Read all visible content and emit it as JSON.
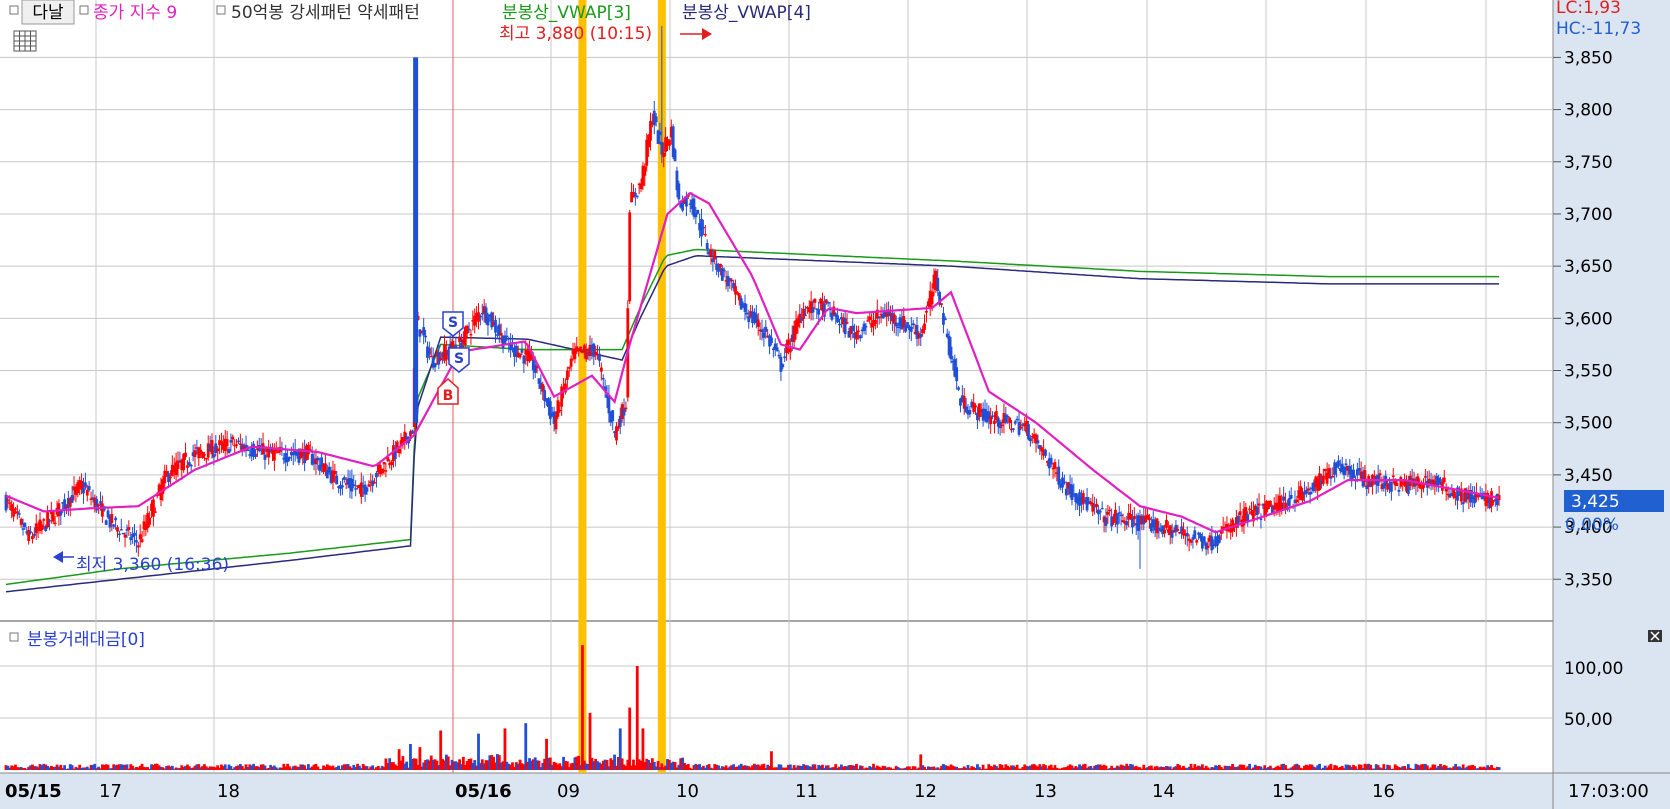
{
  "colors": {
    "up": "#ff0000",
    "down": "#1f4fd6",
    "ma": "#e020c0",
    "vwap3": "#1a9a1a",
    "vwap4": "#2a2a7a",
    "highlight": "#ffc000",
    "grid": "#c8c8c8",
    "axis_bg": "#dbe5f1",
    "price_badge": "#2060d0"
  },
  "header": {
    "button_label": "다날",
    "ma_label": "종가 지수 9",
    "pattern_label": "50억봉 강세패턴 약세패턴",
    "vwap3_label": "분봉상_VWAP[3]",
    "vwap4_label": "분봉상_VWAP[4]",
    "lc_label": "LC:1,93",
    "hc_label": "HC:-11,73"
  },
  "annotations": {
    "high_label": "최고 3,880 (10:15)",
    "low_label": "최저 3,360 (16:36)",
    "current_price": "3,425",
    "current_change": "0,00%",
    "signals": [
      "S",
      "S",
      "B"
    ]
  },
  "volume_panel": {
    "title": "분봉거래대금[0]",
    "close_icon": "x",
    "ticks": [
      "100,00",
      "50,00"
    ]
  },
  "time_axis": {
    "labels": [
      "05/15",
      "17",
      "18",
      "05/16",
      "09",
      "10",
      "11",
      "12",
      "13",
      "14",
      "15",
      "16"
    ],
    "current_time": "17:03:00"
  },
  "chart_data": {
    "type": "candlestick",
    "price_axis": {
      "ticks": [
        "3,850",
        "3,800",
        "3,750",
        "3,700",
        "3,650",
        "3,600",
        "3,550",
        "3,500",
        "3,450",
        "3,400",
        "3,350"
      ],
      "range": [
        3310,
        3905
      ]
    },
    "volume_axis": {
      "range": [
        0,
        125
      ]
    },
    "sessions": [
      {
        "date": "05/15",
        "hours": [
          "16",
          "17",
          "18"
        ]
      },
      {
        "date": "05/16",
        "hours": [
          "08",
          "09",
          "10",
          "11",
          "12",
          "13",
          "14",
          "15",
          "16"
        ]
      }
    ],
    "high": {
      "value": 3880,
      "time": "10:15"
    },
    "low": {
      "value": 3360,
      "time": "16:36"
    },
    "last_close": 3425,
    "price_anchors": [
      [
        0,
        3425
      ],
      [
        12,
        3390
      ],
      [
        25,
        3410
      ],
      [
        40,
        3440
      ],
      [
        55,
        3405
      ],
      [
        70,
        3385
      ],
      [
        85,
        3450
      ],
      [
        100,
        3470
      ],
      [
        120,
        3480
      ],
      [
        140,
        3470
      ],
      [
        160,
        3470
      ],
      [
        175,
        3445
      ],
      [
        188,
        3435
      ],
      [
        200,
        3460
      ],
      [
        210,
        3480
      ],
      [
        215,
        3495
      ],
      [
        217,
        3600
      ],
      [
        225,
        3560
      ],
      [
        240,
        3575
      ],
      [
        252,
        3610
      ],
      [
        265,
        3575
      ],
      [
        278,
        3560
      ],
      [
        290,
        3500
      ],
      [
        300,
        3565
      ],
      [
        312,
        3570
      ],
      [
        322,
        3490
      ],
      [
        328,
        3520
      ],
      [
        330,
        3710
      ],
      [
        336,
        3730
      ],
      [
        342,
        3795
      ],
      [
        347,
        3760
      ],
      [
        352,
        3780
      ],
      [
        356,
        3710
      ],
      [
        362,
        3715
      ],
      [
        372,
        3665
      ],
      [
        390,
        3610
      ],
      [
        402,
        3585
      ],
      [
        410,
        3555
      ],
      [
        422,
        3610
      ],
      [
        434,
        3610
      ],
      [
        448,
        3585
      ],
      [
        465,
        3605
      ],
      [
        484,
        3585
      ],
      [
        492,
        3640
      ],
      [
        496,
        3600
      ],
      [
        505,
        3520
      ],
      [
        520,
        3505
      ],
      [
        540,
        3495
      ],
      [
        560,
        3440
      ],
      [
        580,
        3410
      ],
      [
        600,
        3405
      ],
      [
        620,
        3395
      ],
      [
        637,
        3385
      ],
      [
        655,
        3410
      ],
      [
        672,
        3420
      ],
      [
        690,
        3435
      ],
      [
        705,
        3460
      ],
      [
        720,
        3445
      ],
      [
        740,
        3440
      ],
      [
        754,
        3445
      ],
      [
        770,
        3430
      ],
      [
        790,
        3425
      ]
    ],
    "ma_anchors": [
      [
        0,
        3430
      ],
      [
        20,
        3415
      ],
      [
        45,
        3418
      ],
      [
        70,
        3420
      ],
      [
        100,
        3455
      ],
      [
        130,
        3477
      ],
      [
        165,
        3472
      ],
      [
        195,
        3458
      ],
      [
        216,
        3488
      ],
      [
        240,
        3568
      ],
      [
        275,
        3578
      ],
      [
        290,
        3525
      ],
      [
        310,
        3545
      ],
      [
        322,
        3520
      ],
      [
        330,
        3575
      ],
      [
        350,
        3700
      ],
      [
        362,
        3720
      ],
      [
        372,
        3710
      ],
      [
        395,
        3640
      ],
      [
        410,
        3575
      ],
      [
        420,
        3570
      ],
      [
        435,
        3610
      ],
      [
        450,
        3605
      ],
      [
        490,
        3610
      ],
      [
        500,
        3625
      ],
      [
        520,
        3530
      ],
      [
        545,
        3500
      ],
      [
        575,
        3455
      ],
      [
        600,
        3420
      ],
      [
        622,
        3410
      ],
      [
        640,
        3395
      ],
      [
        665,
        3410
      ],
      [
        690,
        3425
      ],
      [
        710,
        3445
      ],
      [
        740,
        3445
      ],
      [
        770,
        3435
      ],
      [
        790,
        3428
      ]
    ],
    "vwap3_anchors": [
      [
        0,
        3345
      ],
      [
        60,
        3360
      ],
      [
        150,
        3375
      ],
      [
        214,
        3388
      ],
      [
        217,
        3520
      ],
      [
        230,
        3575
      ],
      [
        276,
        3570
      ],
      [
        326,
        3570
      ],
      [
        335,
        3608
      ],
      [
        349,
        3660
      ],
      [
        365,
        3666
      ],
      [
        500,
        3655
      ],
      [
        600,
        3645
      ],
      [
        700,
        3640
      ],
      [
        790,
        3640
      ]
    ],
    "vwap4_anchors": [
      [
        0,
        3338
      ],
      [
        60,
        3350
      ],
      [
        150,
        3368
      ],
      [
        214,
        3382
      ],
      [
        217,
        3510
      ],
      [
        230,
        3582
      ],
      [
        276,
        3580
      ],
      [
        326,
        3560
      ],
      [
        335,
        3598
      ],
      [
        349,
        3650
      ],
      [
        365,
        3660
      ],
      [
        500,
        3650
      ],
      [
        600,
        3638
      ],
      [
        700,
        3633
      ],
      [
        790,
        3633
      ]
    ],
    "volume_spikes": [
      [
        305,
        120
      ],
      [
        309,
        55
      ],
      [
        325,
        40
      ],
      [
        330,
        60
      ],
      [
        334,
        100
      ],
      [
        337,
        40
      ],
      [
        208,
        20
      ],
      [
        214,
        25
      ],
      [
        219,
        22
      ],
      [
        230,
        38
      ],
      [
        250,
        35
      ],
      [
        264,
        40
      ],
      [
        275,
        45
      ],
      [
        286,
        30
      ],
      [
        484,
        15
      ],
      [
        405,
        18
      ]
    ]
  }
}
